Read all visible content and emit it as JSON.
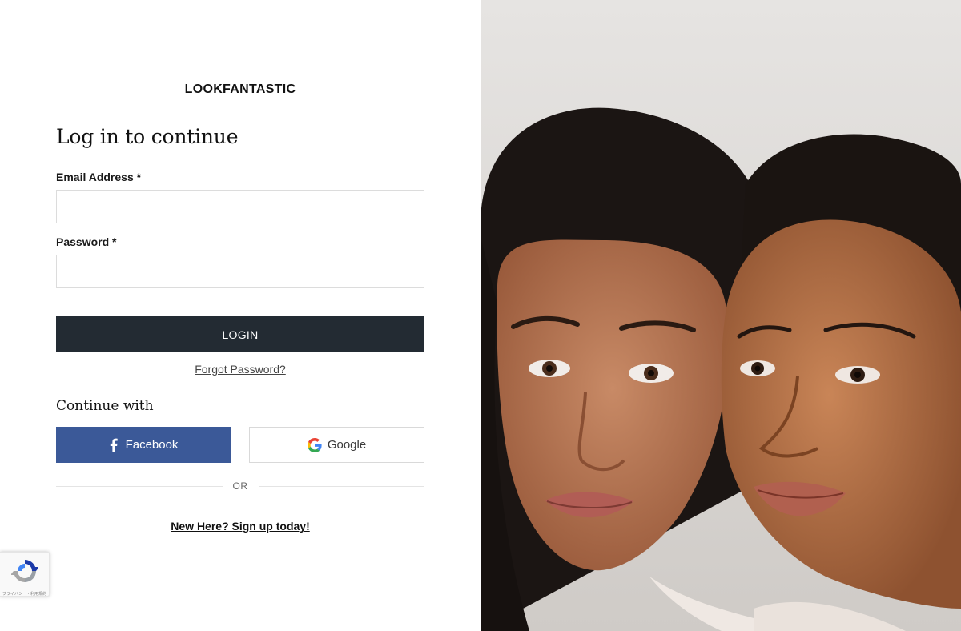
{
  "brand": {
    "logo_text": "LOOKFANTASTIC"
  },
  "login_form": {
    "heading": "Log in to continue",
    "email_label": "Email Address *",
    "email_value": "",
    "password_label": "Password *",
    "password_value": "",
    "submit_label": "LOGIN",
    "forgot_password": "Forgot Password?"
  },
  "social": {
    "heading": "Continue with",
    "facebook_label": "Facebook",
    "google_label": "Google",
    "facebook_color": "#3b5998"
  },
  "divider": {
    "text": "OR"
  },
  "signup": {
    "link_text": "New Here? Sign up today!"
  },
  "recaptcha": {
    "text": "プライバシー・利用規約"
  },
  "colors": {
    "login_button": "#232b33",
    "input_border": "#dcdcdc"
  },
  "hero_image": {
    "icon": "hero-photo",
    "alt": "two-women-portrait"
  }
}
